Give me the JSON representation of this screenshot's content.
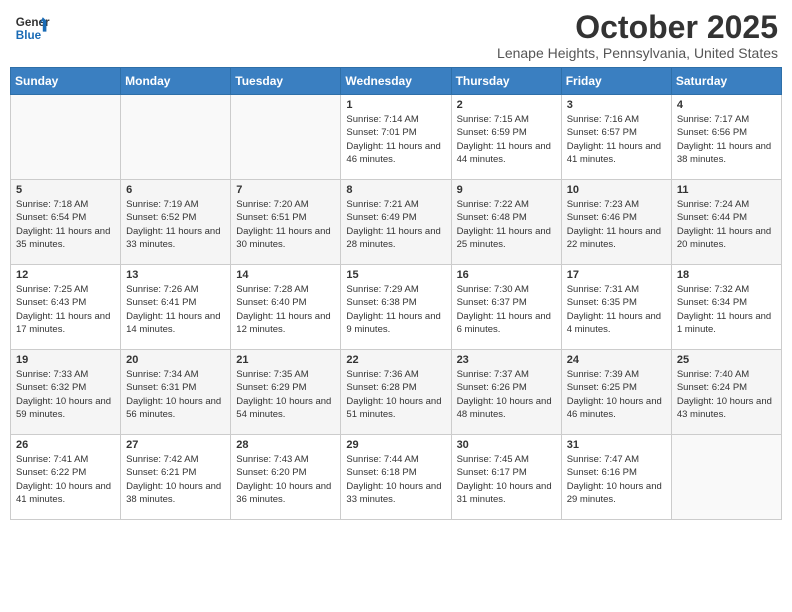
{
  "header": {
    "logo_line1": "General",
    "logo_line2": "Blue",
    "month": "October 2025",
    "location": "Lenape Heights, Pennsylvania, United States"
  },
  "days_of_week": [
    "Sunday",
    "Monday",
    "Tuesday",
    "Wednesday",
    "Thursday",
    "Friday",
    "Saturday"
  ],
  "weeks": [
    [
      {
        "day": "",
        "info": ""
      },
      {
        "day": "",
        "info": ""
      },
      {
        "day": "",
        "info": ""
      },
      {
        "day": "1",
        "info": "Sunrise: 7:14 AM\nSunset: 7:01 PM\nDaylight: 11 hours and 46 minutes."
      },
      {
        "day": "2",
        "info": "Sunrise: 7:15 AM\nSunset: 6:59 PM\nDaylight: 11 hours and 44 minutes."
      },
      {
        "day": "3",
        "info": "Sunrise: 7:16 AM\nSunset: 6:57 PM\nDaylight: 11 hours and 41 minutes."
      },
      {
        "day": "4",
        "info": "Sunrise: 7:17 AM\nSunset: 6:56 PM\nDaylight: 11 hours and 38 minutes."
      }
    ],
    [
      {
        "day": "5",
        "info": "Sunrise: 7:18 AM\nSunset: 6:54 PM\nDaylight: 11 hours and 35 minutes."
      },
      {
        "day": "6",
        "info": "Sunrise: 7:19 AM\nSunset: 6:52 PM\nDaylight: 11 hours and 33 minutes."
      },
      {
        "day": "7",
        "info": "Sunrise: 7:20 AM\nSunset: 6:51 PM\nDaylight: 11 hours and 30 minutes."
      },
      {
        "day": "8",
        "info": "Sunrise: 7:21 AM\nSunset: 6:49 PM\nDaylight: 11 hours and 28 minutes."
      },
      {
        "day": "9",
        "info": "Sunrise: 7:22 AM\nSunset: 6:48 PM\nDaylight: 11 hours and 25 minutes."
      },
      {
        "day": "10",
        "info": "Sunrise: 7:23 AM\nSunset: 6:46 PM\nDaylight: 11 hours and 22 minutes."
      },
      {
        "day": "11",
        "info": "Sunrise: 7:24 AM\nSunset: 6:44 PM\nDaylight: 11 hours and 20 minutes."
      }
    ],
    [
      {
        "day": "12",
        "info": "Sunrise: 7:25 AM\nSunset: 6:43 PM\nDaylight: 11 hours and 17 minutes."
      },
      {
        "day": "13",
        "info": "Sunrise: 7:26 AM\nSunset: 6:41 PM\nDaylight: 11 hours and 14 minutes."
      },
      {
        "day": "14",
        "info": "Sunrise: 7:28 AM\nSunset: 6:40 PM\nDaylight: 11 hours and 12 minutes."
      },
      {
        "day": "15",
        "info": "Sunrise: 7:29 AM\nSunset: 6:38 PM\nDaylight: 11 hours and 9 minutes."
      },
      {
        "day": "16",
        "info": "Sunrise: 7:30 AM\nSunset: 6:37 PM\nDaylight: 11 hours and 6 minutes."
      },
      {
        "day": "17",
        "info": "Sunrise: 7:31 AM\nSunset: 6:35 PM\nDaylight: 11 hours and 4 minutes."
      },
      {
        "day": "18",
        "info": "Sunrise: 7:32 AM\nSunset: 6:34 PM\nDaylight: 11 hours and 1 minute."
      }
    ],
    [
      {
        "day": "19",
        "info": "Sunrise: 7:33 AM\nSunset: 6:32 PM\nDaylight: 10 hours and 59 minutes."
      },
      {
        "day": "20",
        "info": "Sunrise: 7:34 AM\nSunset: 6:31 PM\nDaylight: 10 hours and 56 minutes."
      },
      {
        "day": "21",
        "info": "Sunrise: 7:35 AM\nSunset: 6:29 PM\nDaylight: 10 hours and 54 minutes."
      },
      {
        "day": "22",
        "info": "Sunrise: 7:36 AM\nSunset: 6:28 PM\nDaylight: 10 hours and 51 minutes."
      },
      {
        "day": "23",
        "info": "Sunrise: 7:37 AM\nSunset: 6:26 PM\nDaylight: 10 hours and 48 minutes."
      },
      {
        "day": "24",
        "info": "Sunrise: 7:39 AM\nSunset: 6:25 PM\nDaylight: 10 hours and 46 minutes."
      },
      {
        "day": "25",
        "info": "Sunrise: 7:40 AM\nSunset: 6:24 PM\nDaylight: 10 hours and 43 minutes."
      }
    ],
    [
      {
        "day": "26",
        "info": "Sunrise: 7:41 AM\nSunset: 6:22 PM\nDaylight: 10 hours and 41 minutes."
      },
      {
        "day": "27",
        "info": "Sunrise: 7:42 AM\nSunset: 6:21 PM\nDaylight: 10 hours and 38 minutes."
      },
      {
        "day": "28",
        "info": "Sunrise: 7:43 AM\nSunset: 6:20 PM\nDaylight: 10 hours and 36 minutes."
      },
      {
        "day": "29",
        "info": "Sunrise: 7:44 AM\nSunset: 6:18 PM\nDaylight: 10 hours and 33 minutes."
      },
      {
        "day": "30",
        "info": "Sunrise: 7:45 AM\nSunset: 6:17 PM\nDaylight: 10 hours and 31 minutes."
      },
      {
        "day": "31",
        "info": "Sunrise: 7:47 AM\nSunset: 6:16 PM\nDaylight: 10 hours and 29 minutes."
      },
      {
        "day": "",
        "info": ""
      }
    ]
  ]
}
